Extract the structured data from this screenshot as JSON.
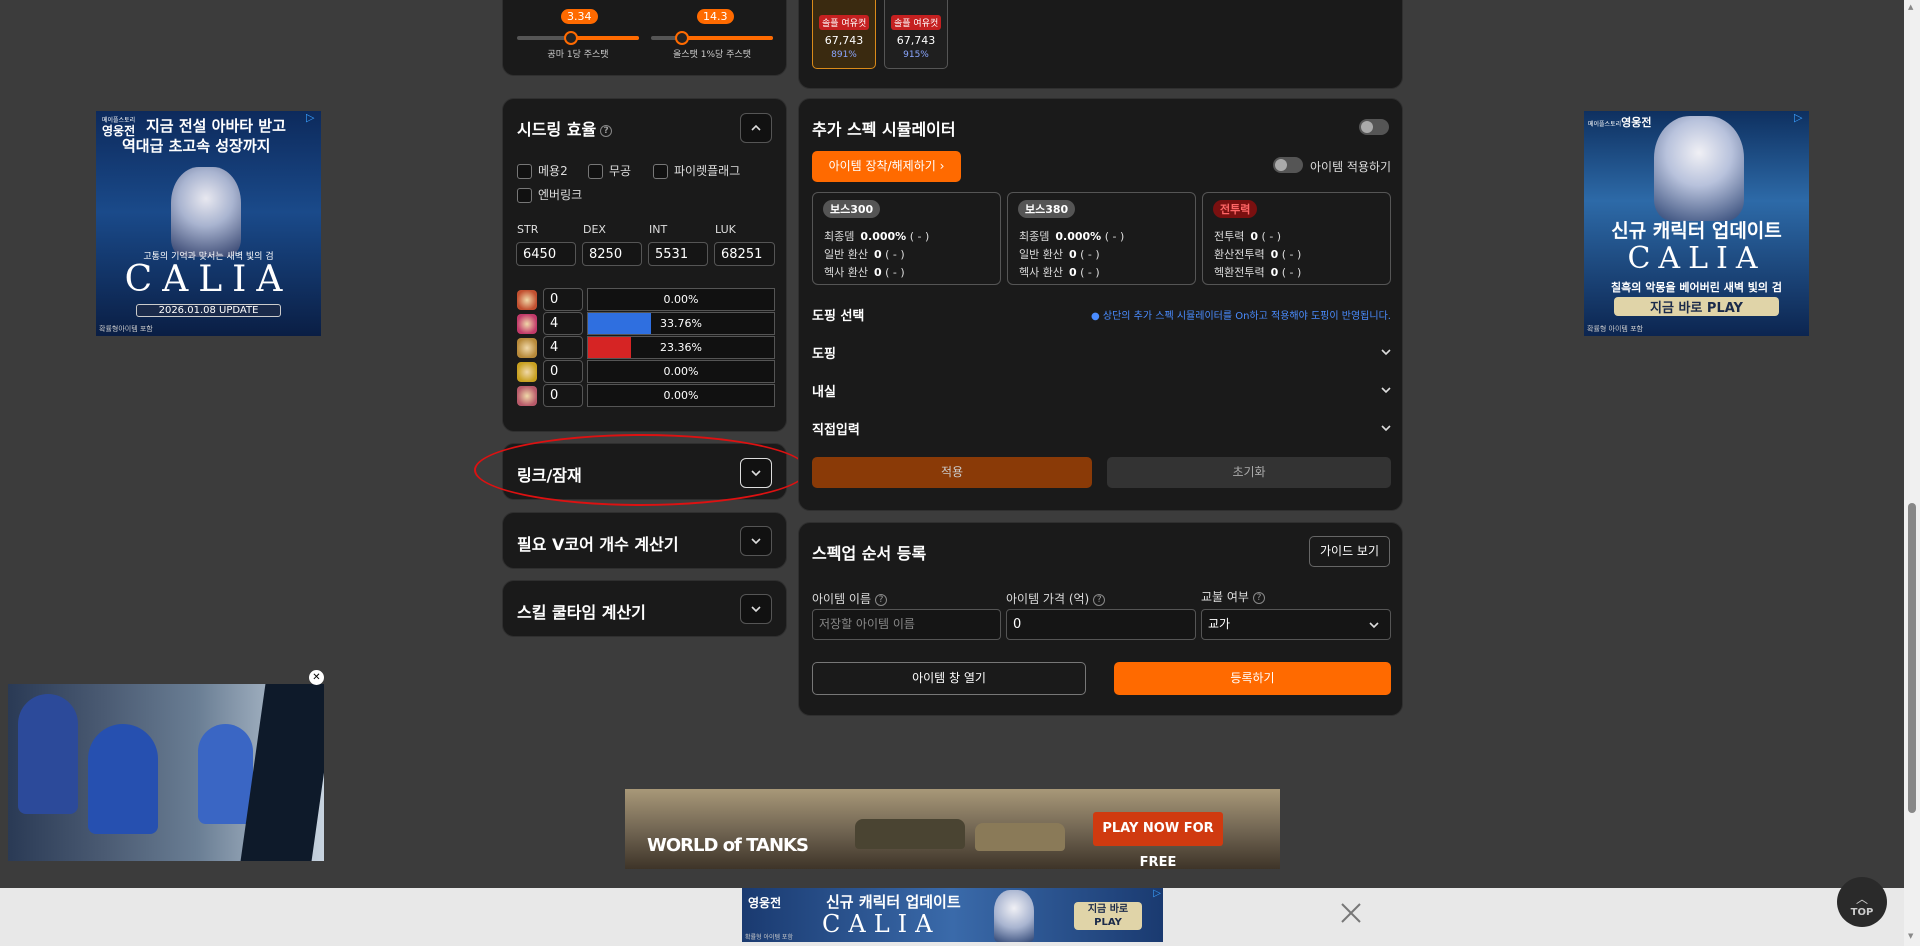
{
  "sliders": {
    "left": {
      "value": "3.34",
      "label": "공마 1당 주스탯"
    },
    "right": {
      "value": "14.3",
      "label": "올스탯 1%당 주스탯"
    }
  },
  "top_cards": [
    {
      "badge": "솔플 여유컷",
      "value": "67,743",
      "pct": "891%"
    },
    {
      "badge": "솔플 여유컷",
      "value": "67,743",
      "pct": "915%"
    }
  ],
  "seed": {
    "title": "시드링 효율",
    "checks": [
      "메용2",
      "무공",
      "파이렛플래그",
      "엔버링크"
    ],
    "stat_labels": [
      "STR",
      "DEX",
      "INT",
      "LUK"
    ],
    "stat_values": [
      "6450",
      "8250",
      "5531",
      "68251"
    ],
    "rings": [
      {
        "value": "0",
        "pct": "0.00%",
        "fill": 0,
        "color": "#1a1a1a"
      },
      {
        "value": "4",
        "pct": "33.76%",
        "fill": 33.76,
        "color": "#2f6fe0"
      },
      {
        "value": "4",
        "pct": "23.36%",
        "fill": 23.36,
        "color": "#d62424"
      },
      {
        "value": "0",
        "pct": "0.00%",
        "fill": 0,
        "color": "#1a1a1a"
      },
      {
        "value": "0",
        "pct": "0.00%",
        "fill": 0,
        "color": "#1a1a1a"
      }
    ]
  },
  "link": {
    "title": "링크/잠재"
  },
  "vcore": {
    "title": "필요 V코어 개수 계산기"
  },
  "cooldown": {
    "title": "스킬 쿨타임 계산기"
  },
  "sim": {
    "title": "추가 스펙 시뮬레이터",
    "equip_button": "아이템 장착/해제하기",
    "apply_item_label": "아이템 적용하기",
    "cards": [
      {
        "tag": "보스300",
        "rows": [
          {
            "k": "최종뎀",
            "v": "0.000%",
            "d": "( - )"
          },
          {
            "k": "일반 환산",
            "v": "0",
            "d": "( - )"
          },
          {
            "k": "헥사 환산",
            "v": "0",
            "d": "( - )"
          }
        ]
      },
      {
        "tag": "보스380",
        "rows": [
          {
            "k": "최종뎀",
            "v": "0.000%",
            "d": "( - )"
          },
          {
            "k": "일반 환산",
            "v": "0",
            "d": "( - )"
          },
          {
            "k": "헥사 환산",
            "v": "0",
            "d": "( - )"
          }
        ]
      },
      {
        "tag": "전투력",
        "rows": [
          {
            "k": "전투력",
            "v": "0",
            "d": "( - )"
          },
          {
            "k": "환산전투력",
            "v": "0",
            "d": "( - )"
          },
          {
            "k": "헥환전투력",
            "v": "0",
            "d": "( - )"
          }
        ]
      }
    ],
    "doping_title": "도핑 선택",
    "doping_note": "● 상단의 추가 스펙 시뮬레이터를 On하고 적용해야 도핑이 반영됩니다.",
    "rows": [
      "도핑",
      "내실",
      "직접입력"
    ],
    "apply_button": "적용",
    "reset_button": "초기화"
  },
  "specup": {
    "title": "스펙업 순서 등록",
    "guide_button": "가이드 보기",
    "name_label": "아이템 이름",
    "price_label": "아이템 가격 (억)",
    "trade_label": "교불 여부",
    "name_placeholder": "저장할 아이템 이름",
    "price_value": "0",
    "trade_value": "교가",
    "open_button": "아이템 창 열기",
    "register_button": "등록하기"
  },
  "ads": {
    "left": {
      "brand": "메이플스토리",
      "game": "영웅전",
      "line1": "지금 전설 아바타 받고",
      "line2": "역대급 초고속 성장까지",
      "sub": "고통의 기억과 맞서는 새벽 빛의 검",
      "logo": "CALIA",
      "date": "2026.01.08 UPDATE",
      "foot": "확률형아이템 포함"
    },
    "right": {
      "brand": "메이플스토리",
      "game": "영웅전",
      "line1": "신규 캐릭터 업데이트",
      "logo": "CALIA",
      "sub": "칠흑의 악몽을 베어버린 새벽 빛의 검",
      "cta": "지금 바로 PLAY",
      "foot": "확률형 아이템 포함"
    },
    "tanks": {
      "logo": "WORLD of TANKS",
      "cta": "PLAY NOW FOR FREE"
    },
    "bottom": {
      "game": "영웅전",
      "line1": "신규 캐릭터 업데이트",
      "logo": "CALIA",
      "cta": "지금 바로 PLAY",
      "foot": "확률형 아이템 포함"
    }
  },
  "top_button": "TOP"
}
